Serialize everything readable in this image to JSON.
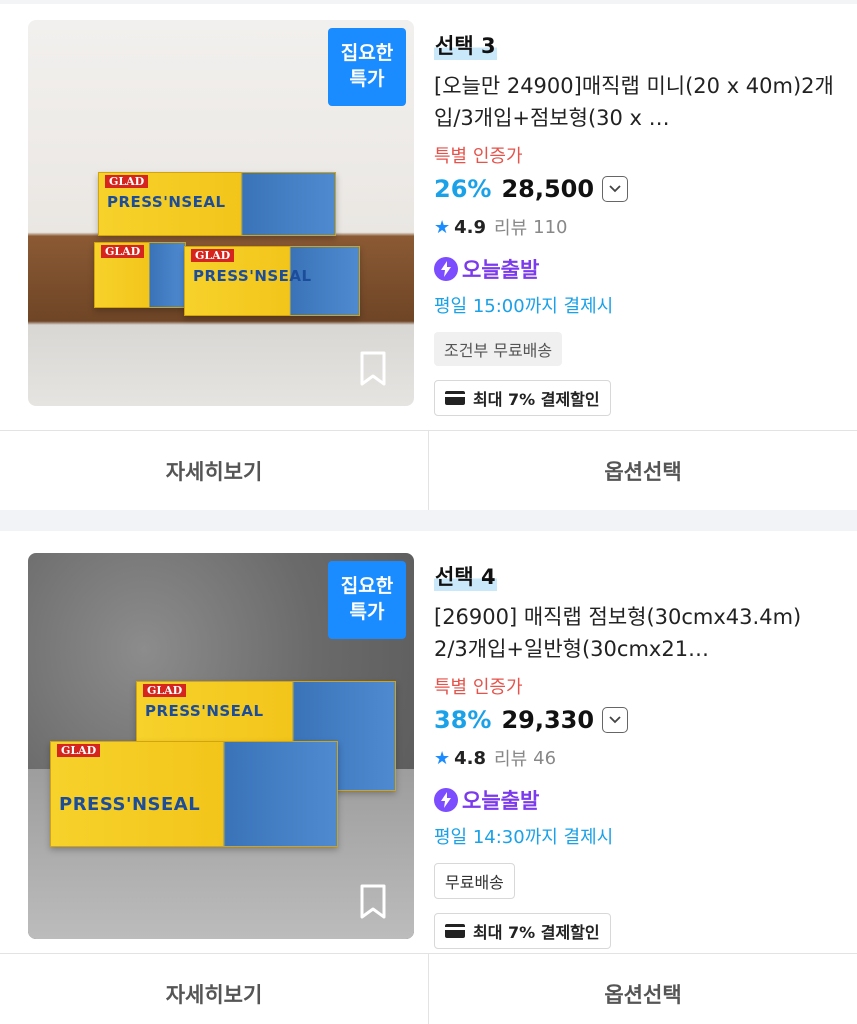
{
  "products": [
    {
      "badge": "집요한\n특가",
      "title": "선택 3",
      "name": "[오늘만 24900]매직랩 미니(20 x 40m)2개입/3개입+점보형(30 x …",
      "special": "특별 인증가",
      "discount": "26%",
      "price": "28,500",
      "rating": "4.9",
      "review_label": "리뷰",
      "review_count": "110",
      "today": "오늘출발",
      "deadline": "평일 15:00까지 결제시",
      "shipping": "조건부 무료배송",
      "payment": "최대 7% 결제할인",
      "box_brand": "GLAD",
      "box_name": "PRESS'NSEAL"
    },
    {
      "badge": "집요한\n특가",
      "title": "선택 4",
      "name": "[26900] 매직랩 점보형(30cmx43.4m) 2/3개입+일반형(30cmx21…",
      "special": "특별 인증가",
      "discount": "38%",
      "price": "29,330",
      "rating": "4.8",
      "review_label": "리뷰",
      "review_count": "46",
      "today": "오늘출발",
      "deadline": "평일 14:30까지 결제시",
      "shipping": "무료배송",
      "payment": "최대 7% 결제할인",
      "box_brand": "GLAD",
      "box_name": "PRESS'NSEAL"
    }
  ],
  "buttons": {
    "details": "자세히보기",
    "options": "옵션선택"
  },
  "colors": {
    "accent_blue": "#1a8cff",
    "discount": "#1aa1e8",
    "special": "#e5534b",
    "today_purple": "#7c3aed"
  }
}
